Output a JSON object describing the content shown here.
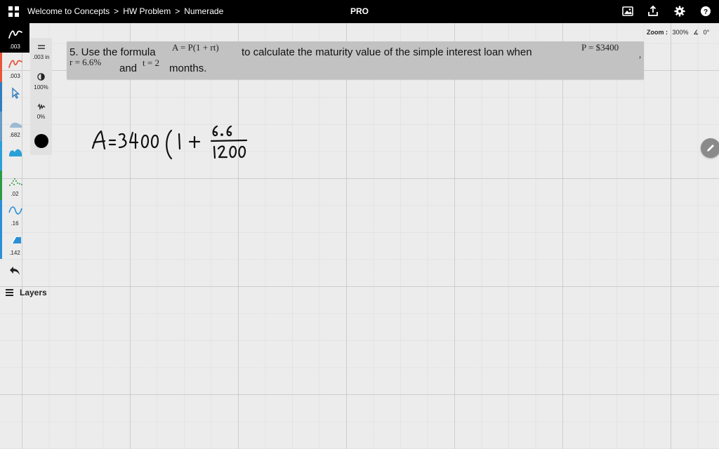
{
  "breadcrumb": {
    "items": [
      "Welcome to Concepts",
      "HW Problem",
      "Numerade"
    ],
    "separator": ">"
  },
  "header": {
    "badge": "PRO"
  },
  "top_icons": [
    "image-icon",
    "export-icon",
    "gear-icon",
    "help-icon"
  ],
  "zoom": {
    "label": "Zoom :",
    "value": "300%",
    "angle": "0°"
  },
  "tools": [
    {
      "name": "pen",
      "value": ".003",
      "color": "#ffffff",
      "active": true
    },
    {
      "name": "pen-red",
      "value": ".003",
      "color": "#e8553a",
      "active": false
    },
    {
      "name": "selection",
      "value": "",
      "color": "#2e7dbf",
      "active": false
    },
    {
      "name": "airbrush",
      "value": ".682",
      "color": "#6a9cc4",
      "active": false
    },
    {
      "name": "watercolor",
      "value": "",
      "color": "#2aa0d8",
      "active": false
    },
    {
      "name": "scatter",
      "value": ".02",
      "color": "#2c9a46",
      "active": false
    },
    {
      "name": "curve",
      "value": ".16",
      "color": "#2a8fd6",
      "active": false
    },
    {
      "name": "eraser",
      "value": ".142",
      "color": "#2a8fd6",
      "active": false
    }
  ],
  "tool_bar_colors": [
    "#000000",
    "#e8553a",
    "#2e7dbf",
    "#6a9cc4",
    "#2aa0d8",
    "#2c9a46",
    "#2a8fd6",
    "#2a8fd6"
  ],
  "layers_label": "Layers",
  "settings": {
    "size": ".003 in",
    "opacity": "100%",
    "smoothing": "0%",
    "color": "#000000"
  },
  "question": {
    "intro": "5. Use the formula",
    "formula": "A = P(1 + rt)",
    "middle": "to calculate the maturity value of the simple interest loan when",
    "p_value": "P = $3400",
    "comma": ",",
    "r_value": "r = 6.6%",
    "and": "and",
    "t_value": "t = 2",
    "end": "months."
  },
  "handwriting": {
    "line": "A = 3400 ( 1 + 6.6 / 1200",
    "lhs": "A",
    "principal": "3400",
    "numerator": "6.6",
    "denominator": "1200"
  },
  "colors": {
    "topbar": "#000000",
    "canvas": "#ececec",
    "question_bg": "#c2c2c2",
    "fab": "#8a8a8a"
  }
}
